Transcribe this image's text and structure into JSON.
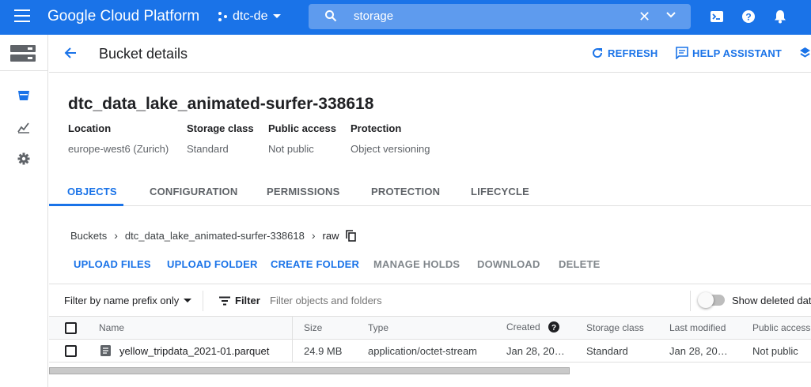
{
  "topbar": {
    "title": "Google Cloud Platform",
    "project": "dtc-de",
    "search_value": "storage",
    "accent": "#1a73e8"
  },
  "header": {
    "title": "Bucket details",
    "refresh_label": "REFRESH",
    "help_label": "HELP ASSISTANT"
  },
  "bucket": {
    "name": "dtc_data_lake_animated-surfer-338618",
    "meta": [
      {
        "label": "Location",
        "value": "europe-west6 (Zurich)"
      },
      {
        "label": "Storage class",
        "value": "Standard"
      },
      {
        "label": "Public access",
        "value": "Not public"
      },
      {
        "label": "Protection",
        "value": "Object versioning"
      }
    ]
  },
  "tabs": [
    "OBJECTS",
    "CONFIGURATION",
    "PERMISSIONS",
    "PROTECTION",
    "LIFECYCLE"
  ],
  "breadcrumb": [
    "Buckets",
    "dtc_data_lake_animated-surfer-338618",
    "raw"
  ],
  "actions": [
    "UPLOAD FILES",
    "UPLOAD FOLDER",
    "CREATE FOLDER",
    "MANAGE HOLDS",
    "DOWNLOAD",
    "DELETE"
  ],
  "filter": {
    "prefix_label": "Filter by name prefix only",
    "filter_label": "Filter",
    "placeholder": "Filter objects and folders",
    "toggle_label": "Show deleted data"
  },
  "table": {
    "columns": [
      "Name",
      "Size",
      "Type",
      "Created",
      "Storage class",
      "Last modified",
      "Public access"
    ],
    "rows": [
      {
        "name": "yellow_tripdata_2021-01.parquet",
        "size": "24.9 MB",
        "type": "application/octet-stream",
        "created": "Jan 28, 20…",
        "storage_class": "Standard",
        "last_modified": "Jan 28, 20…",
        "public_access": "Not public"
      }
    ]
  }
}
